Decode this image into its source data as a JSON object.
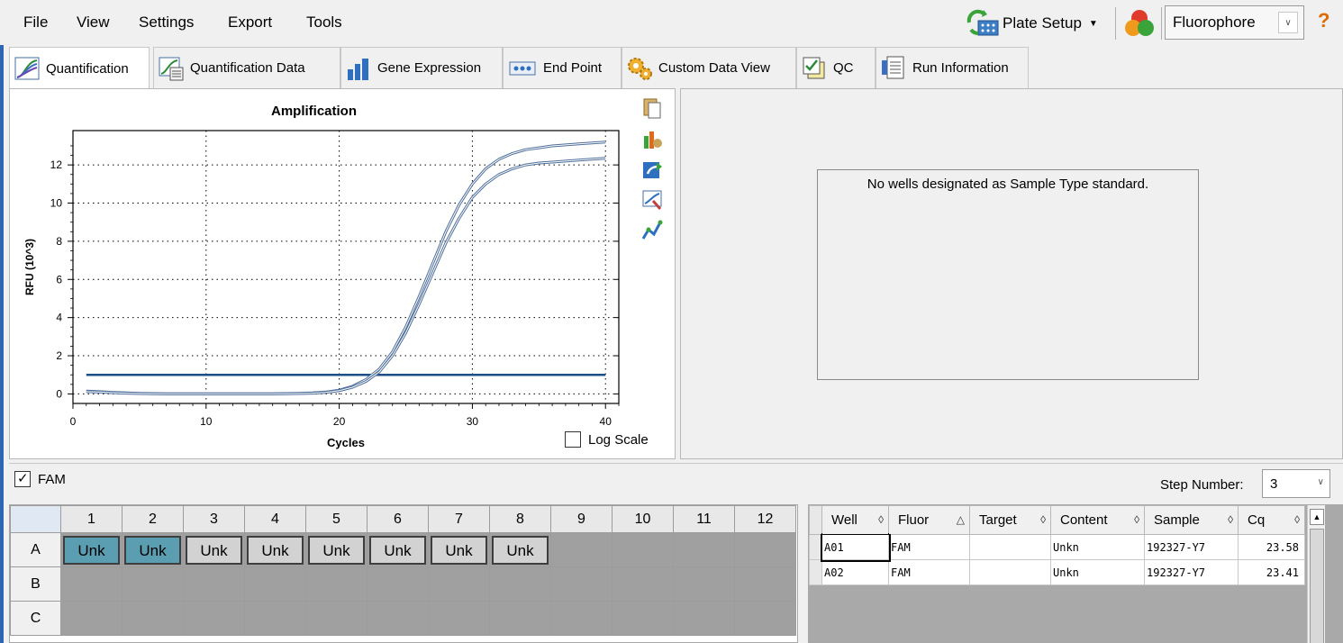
{
  "menu": {
    "items": [
      "File",
      "View",
      "Settings",
      "Export",
      "Tools"
    ],
    "plate_setup": "Plate Setup",
    "fluorophore": "Fluorophore"
  },
  "tabs": [
    {
      "label": "Quantification",
      "icon": "amplification-chart-icon",
      "active": true
    },
    {
      "label": "Quantification Data",
      "icon": "data-sheet-icon"
    },
    {
      "label": "Gene Expression",
      "icon": "bar-chart-icon"
    },
    {
      "label": "End Point",
      "icon": "end-point-icon"
    },
    {
      "label": "Custom Data View",
      "icon": "gears-icon"
    },
    {
      "label": "QC",
      "icon": "qc-check-icon"
    },
    {
      "label": "Run Information",
      "icon": "run-info-icon"
    }
  ],
  "chart_data": {
    "type": "line",
    "title": "Amplification",
    "xlabel": "Cycles",
    "ylabel": "RFU (10^3)",
    "xlim": [
      0,
      41
    ],
    "ylim": [
      -0.5,
      13.8
    ],
    "x_ticks": [
      0,
      10,
      20,
      30,
      40
    ],
    "y_ticks": [
      0,
      2,
      4,
      6,
      8,
      10,
      12
    ],
    "grid": true,
    "threshold": 1.0,
    "series": [
      {
        "x": [
          1,
          2,
          3,
          4,
          5,
          6,
          7,
          8,
          9,
          10,
          11,
          12,
          13,
          14,
          15,
          16,
          17,
          18,
          19,
          20,
          21,
          22,
          23,
          24,
          25,
          26,
          27,
          28,
          29,
          30,
          31,
          32,
          33,
          34,
          35,
          36,
          37,
          38,
          39,
          40
        ],
        "y": [
          0.15,
          0.12,
          0.08,
          0.05,
          0.03,
          0.02,
          0.01,
          0.01,
          0.01,
          0.01,
          0.01,
          0.01,
          0.01,
          0.01,
          0.01,
          0.02,
          0.03,
          0.05,
          0.1,
          0.2,
          0.4,
          0.75,
          1.3,
          2.2,
          3.5,
          5.1,
          6.8,
          8.5,
          9.9,
          11.0,
          11.8,
          12.3,
          12.6,
          12.8,
          12.9,
          13.0,
          13.05,
          13.1,
          13.15,
          13.2
        ]
      },
      {
        "x": [
          1,
          2,
          3,
          4,
          5,
          6,
          7,
          8,
          9,
          10,
          11,
          12,
          13,
          14,
          15,
          16,
          17,
          18,
          19,
          20,
          21,
          22,
          23,
          24,
          25,
          26,
          27,
          28,
          29,
          30,
          31,
          32,
          33,
          34,
          35,
          36,
          37,
          38,
          39,
          40
        ],
        "y": [
          0.12,
          0.1,
          0.06,
          0.04,
          0.02,
          0.01,
          0.0,
          0.0,
          0.0,
          0.0,
          0.0,
          0.0,
          0.0,
          0.0,
          0.0,
          0.01,
          0.02,
          0.04,
          0.08,
          0.17,
          0.35,
          0.65,
          1.15,
          2.0,
          3.2,
          4.7,
          6.3,
          7.9,
          9.2,
          10.3,
          11.0,
          11.5,
          11.8,
          12.0,
          12.1,
          12.15,
          12.2,
          12.25,
          12.3,
          12.35
        ]
      }
    ]
  },
  "chart": {
    "log_scale_label": "Log Scale",
    "side_icons": [
      "copy-icon",
      "chart-options-icon",
      "export-icon",
      "zoom-icon",
      "curve-fit-icon"
    ]
  },
  "std_panel": {
    "message": "No wells designated as Sample Type standard."
  },
  "fam_strip": {
    "fam_label": "FAM",
    "step_label": "Step Number:",
    "step_value": "3"
  },
  "plate": {
    "columns": [
      "1",
      "2",
      "3",
      "4",
      "5",
      "6",
      "7",
      "8",
      "9",
      "10",
      "11",
      "12"
    ],
    "rows": [
      {
        "label": "A",
        "wells": [
          "Unk",
          "Unk",
          "Unk",
          "Unk",
          "Unk",
          "Unk",
          "Unk",
          "Unk",
          "",
          "",
          "",
          ""
        ],
        "selected": [
          true,
          true,
          false,
          false,
          false,
          false,
          false,
          false,
          false,
          false,
          false,
          false
        ]
      },
      {
        "label": "B",
        "wells": [
          "",
          "",
          "",
          "",
          "",
          "",
          "",
          "",
          "",
          "",
          "",
          ""
        ],
        "selected": []
      },
      {
        "label": "C",
        "wells": [
          "",
          "",
          "",
          "",
          "",
          "",
          "",
          "",
          "",
          "",
          "",
          ""
        ],
        "selected": []
      }
    ]
  },
  "results": {
    "headers": [
      "Well",
      "Fluor",
      "Target",
      "Content",
      "Sample",
      "Cq"
    ],
    "sort_icons": [
      "◊",
      "△",
      "◊",
      "◊",
      "◊",
      "◊"
    ],
    "rows": [
      [
        "A01",
        "FAM",
        "",
        "Unkn",
        "192327-Y7",
        "23.58"
      ],
      [
        "A02",
        "FAM",
        "",
        "Unkn",
        "192327-Y7",
        "23.41"
      ]
    ]
  }
}
